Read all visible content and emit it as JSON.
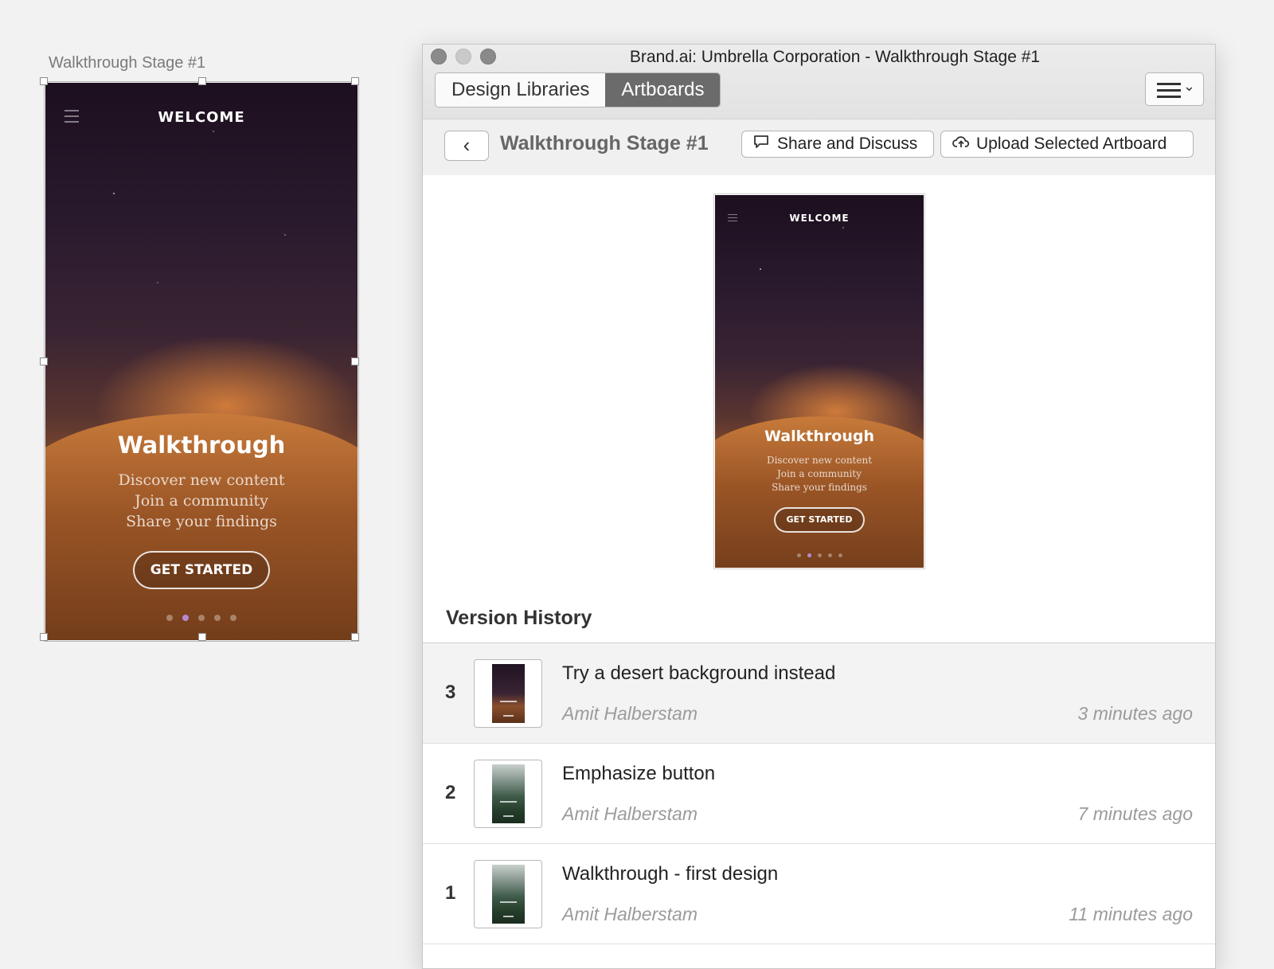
{
  "artboard": {
    "name": "Walkthrough Stage #1",
    "screen": {
      "welcome": "WELCOME",
      "title": "Walkthrough",
      "lines": [
        "Discover new content",
        "Join a community",
        "Share your findings"
      ],
      "cta": "GET STARTED",
      "active_dot": 1,
      "dot_count": 5
    }
  },
  "window": {
    "title": "Brand.ai: Umbrella Corporation - Walkthrough Stage #1",
    "tabs": [
      {
        "label": "Design Libraries",
        "active": false
      },
      {
        "label": "Artboards",
        "active": true
      }
    ],
    "menu_icon": "hamburger-icon"
  },
  "toolbar": {
    "back_icon": "chevron-left-icon",
    "title": "Walkthrough Stage #1",
    "share_label": "Share and Discuss",
    "upload_label": "Upload Selected Artboard"
  },
  "version_history": {
    "title": "Version History",
    "versions": [
      {
        "number": "3",
        "message": "Try a desert background instead",
        "author": "Amit Halberstam",
        "time": "3 minutes ago",
        "theme": "desert",
        "selected": true
      },
      {
        "number": "2",
        "message": "Emphasize button",
        "author": "Amit Halberstam",
        "time": "7 minutes ago",
        "theme": "forest",
        "selected": false
      },
      {
        "number": "1",
        "message": "Walkthrough - first design",
        "author": "Amit Halberstam",
        "time": "11 minutes ago",
        "theme": "forest",
        "selected": false
      }
    ]
  },
  "colors": {
    "active_tab": "#6b6b6b",
    "active_dot": "#b58bd3",
    "canvas_bg": "#f2f2f2"
  }
}
